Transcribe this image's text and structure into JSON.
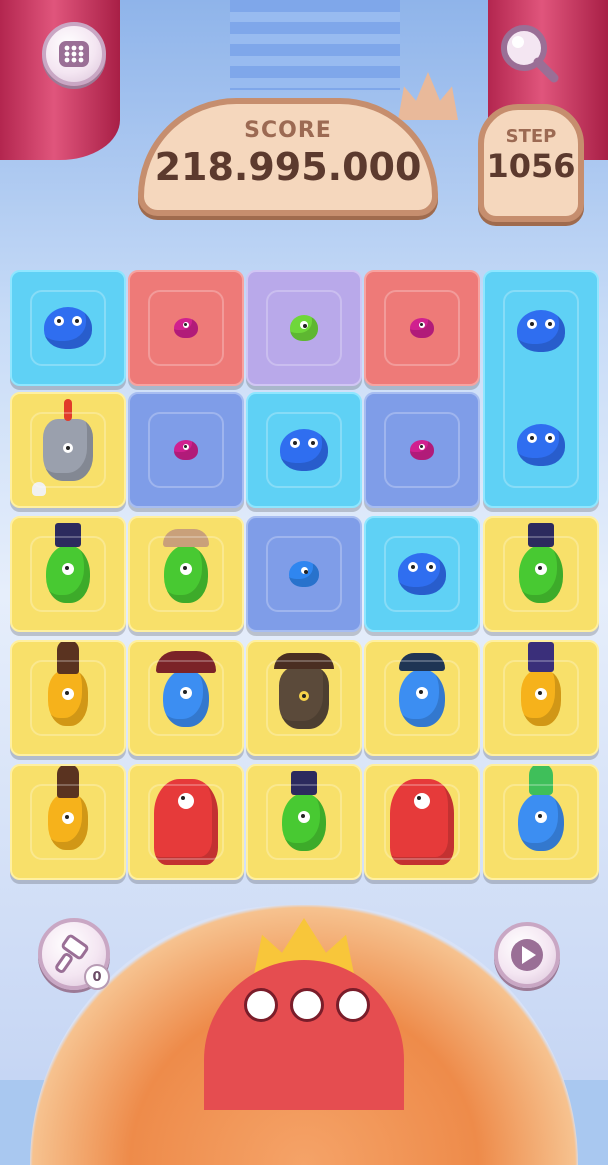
{
  "hud": {
    "score_label": "SCORE",
    "score_value": "218.995.000",
    "step_label": "STEP",
    "step_value": "1056"
  },
  "buttons": {
    "menu_icon": "grid-menu-icon",
    "search_icon": "magnifier-icon",
    "hammer_icon": "hammer-icon",
    "hammer_count": "0",
    "play_icon": "play-icon"
  },
  "colors": {
    "cyan_tile": "#5fd1f5",
    "red_tile": "#ee7a78",
    "lilac_tile": "#b9a9ea",
    "blue_tile": "#7f9de8",
    "yellow_tile": "#f8e06a"
  },
  "board": {
    "rows": [
      [
        "cyan:blue-monster",
        "red:pink-monster",
        "lilac:green-small-monster",
        "red:pink-monster",
        "cyan:blue-monster"
      ],
      [
        "yellow:knight-monster",
        "blue:pink-monster",
        "cyan:blue-monster",
        "blue:pink-monster",
        "cyan:blue-monster"
      ],
      [
        "yellow:green-tophat-monster",
        "yellow:green-monster",
        "blue:blue-small-monster",
        "cyan:blue-monster",
        "yellow:green-tophat-monster"
      ],
      [
        "yellow:yellow-chef-monster",
        "yellow:blue-pirate-monster",
        "yellow:spartan-monster",
        "yellow:blue-tricorn-monster",
        "yellow:yellow-tophat-monster"
      ],
      [
        "yellow:yellow-chef-monster",
        "yellow:red-royal-monster",
        "yellow:green-tophat-monster",
        "yellow:red-royal-monster",
        "yellow:blue-green-hat-monster"
      ]
    ]
  }
}
